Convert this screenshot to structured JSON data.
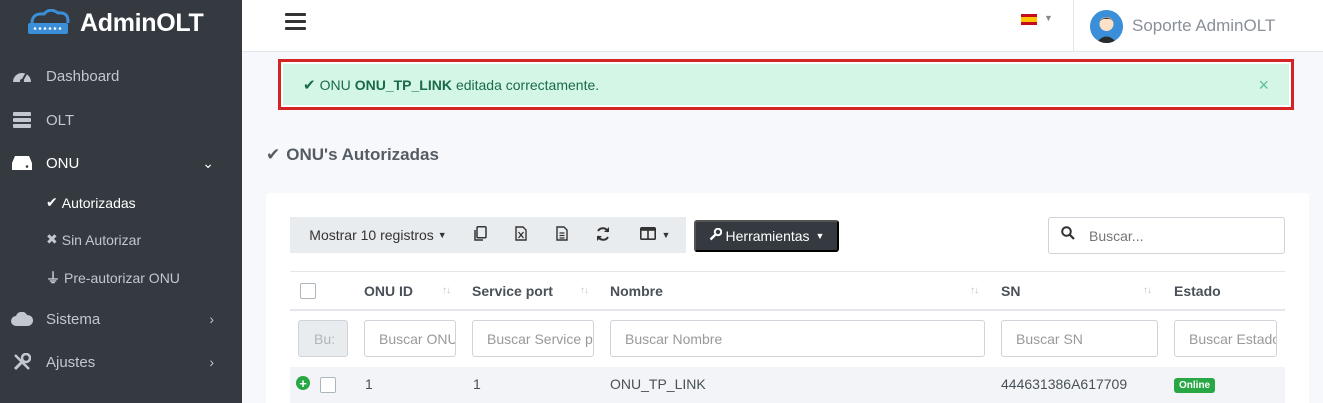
{
  "brand": {
    "name": "AdminOLT"
  },
  "sidebar": {
    "items": [
      {
        "label": "Dashboard",
        "icon": "tachometer-icon"
      },
      {
        "label": "OLT",
        "icon": "server-icon"
      },
      {
        "label": "ONU",
        "icon": "hdd-icon",
        "expanded": true
      },
      {
        "label": "Sistema",
        "icon": "cloud-icon"
      },
      {
        "label": "Ajustes",
        "icon": "tools-icon"
      }
    ],
    "onu_sub": [
      {
        "label": "Autorizadas",
        "mark": "✔"
      },
      {
        "label": "Sin Autorizar",
        "mark": "✖"
      },
      {
        "label": "Pre-autorizar ONU",
        "mark": "⏚"
      }
    ]
  },
  "topbar": {
    "language": "es",
    "user_name": "Soporte AdminOLT"
  },
  "alert": {
    "prefix": "ONU",
    "onu_name": "ONU_TP_LINK",
    "suffix": "editada correctamente.",
    "close": "×",
    "color": "#d4f6e6"
  },
  "section": {
    "title": "ONU's Autorizadas"
  },
  "toolbar": {
    "page_length": "Mostrar 10 registros",
    "tools_label": "Herramientas",
    "search_placeholder": "Buscar..."
  },
  "table": {
    "columns": [
      "ONU ID",
      "Service port",
      "Nombre",
      "SN",
      "Estado"
    ],
    "filters": [
      "Bu:",
      "Buscar ONU ID",
      "Buscar Service port",
      "Buscar Nombre",
      "Buscar SN",
      "Buscar Estado"
    ],
    "rows": [
      {
        "onu_id": "1",
        "service_port": "1",
        "nombre": "ONU_TP_LINK",
        "sn": "444631386A617709",
        "estado": "Online"
      }
    ]
  },
  "colors": {
    "sidebar_bg": "#343a40",
    "alert_border": "#d42424",
    "online_badge": "#28a745"
  }
}
